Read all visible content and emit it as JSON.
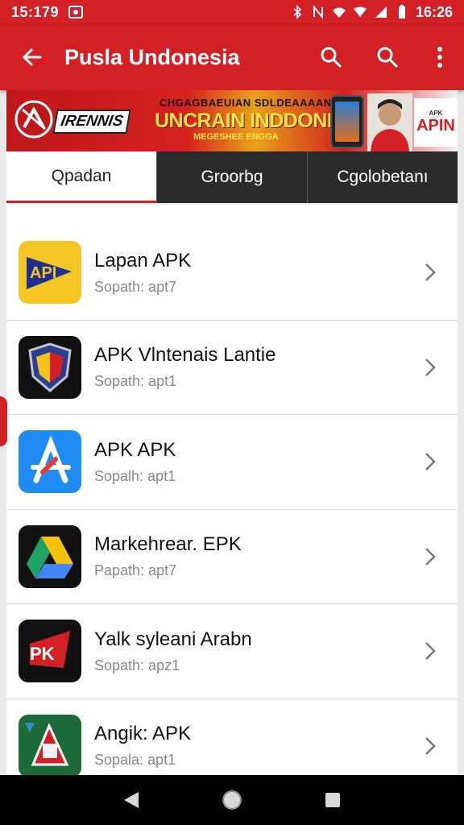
{
  "status_bar": {
    "time_left": "15:179",
    "time_right": "16:26"
  },
  "app_bar": {
    "title": "Pusla Undonesia"
  },
  "banner": {
    "logo_text": "IRENNIS",
    "top_line": "CHGAGBAEUIAN SDLDEAAAAN",
    "main_line": "UNCRAIN INDDONIIA",
    "sub_line": "MEGESHEE ENGGA",
    "brand_small": "APK",
    "brand": "APIN"
  },
  "tabs": [
    {
      "label": "Qpadan",
      "active": true
    },
    {
      "label": "Groorbg",
      "active": false
    },
    {
      "label": "Cgolobetanı",
      "active": false
    }
  ],
  "items": [
    {
      "name": "Lapan APK",
      "sub": "Sopath: apt7",
      "icon": "api-play-icon"
    },
    {
      "name": "APK Vlntenais Lantie",
      "sub": "Sopath: apt1",
      "icon": "shield-icon"
    },
    {
      "name": "APK APK",
      "sub": "Sopalh: apt1",
      "icon": "app-store-icon"
    },
    {
      "name": "Markehrear. EPK",
      "sub": "Papath: apt7",
      "icon": "drive-icon"
    },
    {
      "name": "Yalk syleani Arabn",
      "sub": "Sopath: apz1",
      "icon": "pk-red-icon"
    },
    {
      "name": "Angik: APK",
      "sub": "Sopala: apt1",
      "icon": "angik-icon"
    }
  ],
  "colors": {
    "primary": "#d32024",
    "tab_bar": "#2b2b2b"
  }
}
